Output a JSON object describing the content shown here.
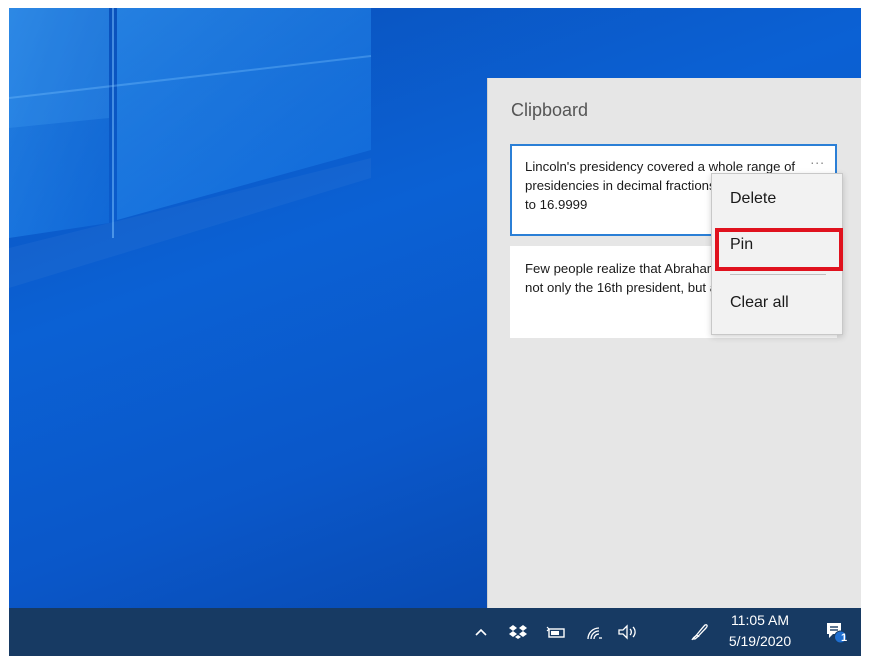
{
  "clipboard": {
    "title": "Clipboard",
    "items": [
      {
        "text": "Lincoln's presidency covered a whole range of presidencies in decimal fractions from 16.0001 to 16.9999"
      },
      {
        "text": "Few people realize that Abraham Lincoln was not only the 16th president, but also the 16.5th"
      }
    ],
    "more_icon": "..."
  },
  "context_menu": {
    "items": [
      {
        "label": "Delete"
      },
      {
        "label": "Pin"
      },
      {
        "label": "Clear all"
      }
    ],
    "highlighted": "Pin",
    "highlight_color": "#e0121e"
  },
  "taskbar": {
    "tray_icons": [
      "chevron-up-icon",
      "dropbox-icon",
      "battery-icon",
      "wifi-icon",
      "volume-icon",
      "pen-icon"
    ],
    "time": "11:05 AM",
    "date": "5/19/2020",
    "notification_count": "1"
  },
  "colors": {
    "desktop": "#0b61d4",
    "taskbar": "#173a63",
    "selection_border": "#2b7fd6"
  }
}
